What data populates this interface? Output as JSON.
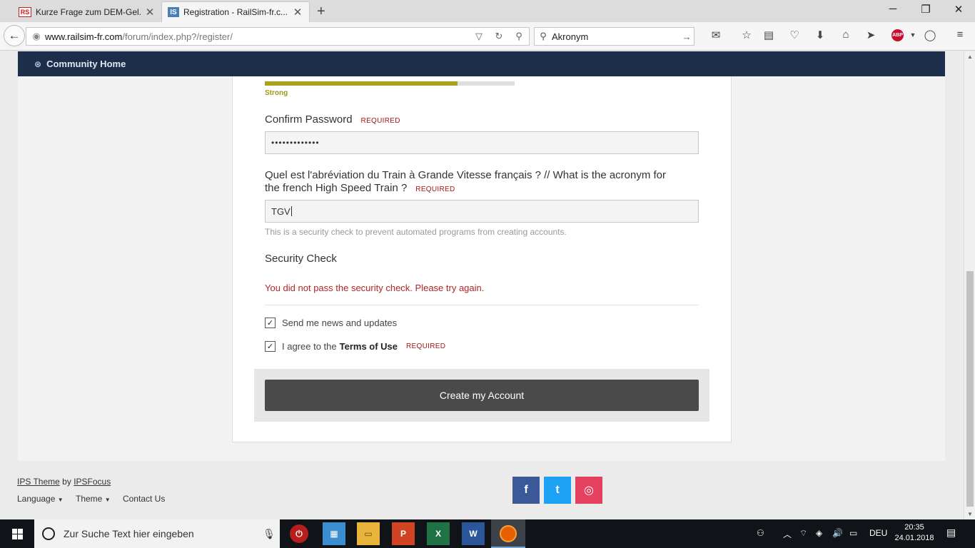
{
  "browser": {
    "tabs": [
      {
        "label": "Kurze Frage zum DEM-Gel...",
        "favicon": "RS"
      },
      {
        "label": "Registration - RailSim-fr.c...",
        "favicon": "IS"
      }
    ],
    "url_host": "www.railsim-fr.com",
    "url_path": "/forum/index.php?/register/",
    "search_value": "Akronym"
  },
  "site": {
    "nav_label": "Community Home"
  },
  "form": {
    "strength_label": "Strong",
    "strength_fraction": 0.77,
    "confirm_label": "Confirm Password",
    "required": "REQUIRED",
    "password_mask": "•••••••••••••",
    "question_line1": "Quel est l'abréviation du Train à Grande Vitesse français ? // What is the acronym for",
    "question_line2": "the french High Speed Train ?",
    "answer_value": "TGV",
    "help_text": "This is a security check to prevent automated programs from creating accounts.",
    "security_label": "Security Check",
    "security_error": "You did not pass the security check. Please try again.",
    "newsletter_label": "Send me news and updates",
    "terms_prefix": "I agree to the",
    "terms_link": "Terms of Use",
    "submit_label": "Create my Account"
  },
  "footer": {
    "theme_text": "IPS Theme",
    "by_text": "by",
    "author": "IPSFocus",
    "language": "Language",
    "theme": "Theme",
    "contact": "Contact Us",
    "social": [
      {
        "name": "facebook",
        "glyph": "f",
        "color": "#3b5998"
      },
      {
        "name": "twitter",
        "glyph": "t",
        "color": "#1da1f2"
      },
      {
        "name": "instagram",
        "glyph": "◎",
        "color": "#e4405f"
      }
    ]
  },
  "taskbar": {
    "search_placeholder": "Zur Suche Text hier eingeben",
    "lang": "DEU",
    "time": "20:35",
    "date": "24.01.2018"
  }
}
